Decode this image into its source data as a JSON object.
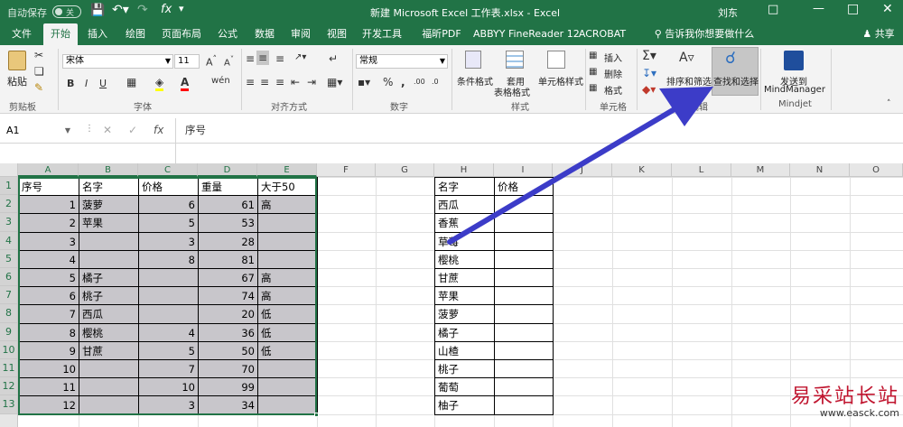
{
  "titlebar": {
    "autosave_label": "自动保存",
    "autosave_state": "关",
    "title": "新建 Microsoft Excel 工作表.xlsx  -  Excel",
    "user": "刘东"
  },
  "tabs": [
    "文件",
    "开始",
    "插入",
    "绘图",
    "页面布局",
    "公式",
    "数据",
    "审阅",
    "视图",
    "开发工具",
    "福昕PDF",
    "ABBYY FineReader 12",
    "ACROBAT"
  ],
  "tell_me": "告诉我你想要做什么",
  "share": "共享",
  "ribbon": {
    "paste": "粘贴",
    "font_name": "宋体",
    "font_size": "11",
    "number_format": "常规",
    "conditional_format": "条件格式",
    "table_format_1": "套用",
    "table_format_2": "表格格式",
    "cell_style": "单元格样式",
    "insert": "插入",
    "delete": "删除",
    "format": "格式",
    "sort_filter": "排序和筛选",
    "find_select": "查找和选择",
    "send_to_1": "发送到",
    "send_to_2": "MindManager",
    "groups": {
      "clipboard": "剪贴板",
      "font": "字体",
      "align": "对齐方式",
      "number": "数字",
      "style": "样式",
      "cells": "单元格",
      "edit": "编辑",
      "mindjet": "Mindjet"
    }
  },
  "formula_bar": {
    "name_box": "A1",
    "fx": "fx",
    "content": "序号"
  },
  "columns": [
    "A",
    "B",
    "C",
    "D",
    "E",
    "F",
    "G",
    "H",
    "I",
    "J",
    "K",
    "L",
    "M",
    "N",
    "O"
  ],
  "rows": [
    "1",
    "2",
    "3",
    "4",
    "5",
    "6",
    "7",
    "8",
    "9",
    "10",
    "11",
    "12",
    "13"
  ],
  "table1": {
    "headers": [
      "序号",
      "名字",
      "价格",
      "重量",
      "大于50"
    ],
    "rows": [
      [
        "1",
        "菠萝",
        "6",
        "61",
        "高"
      ],
      [
        "2",
        "苹果",
        "5",
        "53",
        ""
      ],
      [
        "3",
        "",
        "3",
        "28",
        ""
      ],
      [
        "4",
        "",
        "8",
        "81",
        ""
      ],
      [
        "5",
        "橘子",
        "",
        "67",
        "高"
      ],
      [
        "6",
        "桃子",
        "",
        "74",
        "高"
      ],
      [
        "7",
        "西瓜",
        "",
        "20",
        "低"
      ],
      [
        "8",
        "樱桃",
        "4",
        "36",
        "低"
      ],
      [
        "9",
        "甘蔗",
        "5",
        "50",
        "低"
      ],
      [
        "10",
        "",
        "7",
        "70",
        ""
      ],
      [
        "11",
        "",
        "10",
        "99",
        ""
      ],
      [
        "12",
        "",
        "3",
        "34",
        ""
      ]
    ]
  },
  "table2": {
    "headers": [
      "名字",
      "价格"
    ],
    "names": [
      "西瓜",
      "香蕉",
      "草莓",
      "樱桃",
      "甘蔗",
      "苹果",
      "菠萝",
      "橘子",
      "山楂",
      "桃子",
      "葡萄",
      "柚子"
    ]
  },
  "watermark": {
    "text": "易采站长站",
    "url": "www.easck.com"
  },
  "colors": {
    "excel_green": "#217346",
    "selection_fill": "#c8c6cb",
    "arrow": "#3c3cc8",
    "watermark": "#c0152f"
  }
}
